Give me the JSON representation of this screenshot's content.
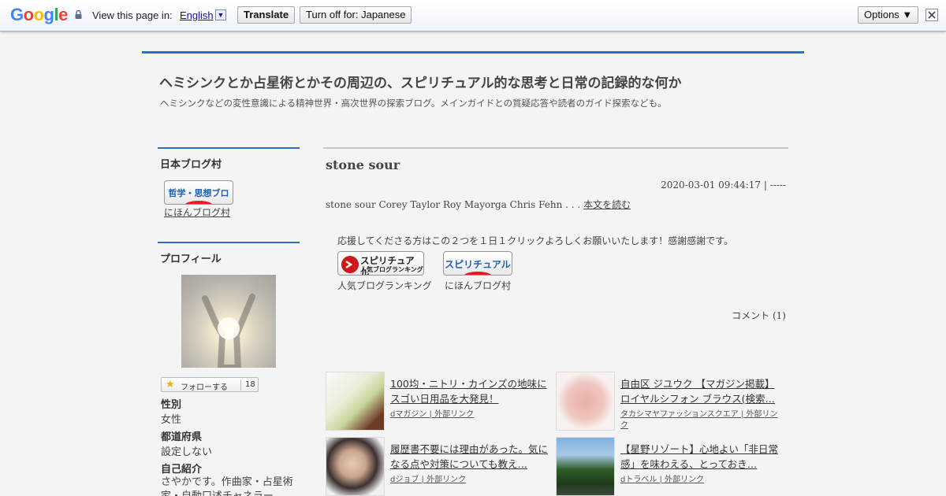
{
  "translate_bar": {
    "logo": "Google",
    "view_in": "View this page in:",
    "language": "English",
    "translate_button": "Translate",
    "turn_off_button": "Turn off for: Japanese",
    "options_button": "Options ▼",
    "icons": [
      "lock-icon",
      "close-icon",
      "dropdown-icon"
    ]
  },
  "blog": {
    "title": "ヘミシンクとか占星術とかその周辺の、スピリチュアル的な思考と日常の記録的な何か",
    "description": "ヘミシンクなどの変性意識による精神世界・高次世界の探索ブログ。メインガイドとの質疑応答や読者のガイド探索なども。"
  },
  "sidebar": {
    "village": {
      "heading": "日本ブログ村",
      "badge_text": "哲学・思想ブログ",
      "link": "にほんブログ村"
    },
    "profile": {
      "heading": "プロフィール",
      "follow_label": "フォローする",
      "follow_count": "18",
      "gender_label": "性別",
      "gender_value": "女性",
      "prefecture_label": "都道府県",
      "prefecture_value": "設定しない",
      "intro_label": "自己紹介",
      "intro_value": "さやかです。作曲家・占星術家・自動口述チャネラー"
    }
  },
  "post": {
    "title": "stone sour",
    "date": "2020-03-01 09:44:17 | -----",
    "body": "stone sour Corey Taylor Roy Mayorga Chris Fehn . . .",
    "read_more": "本文を読む",
    "support_text": "応援してくださる方はこの２つを１日１クリックよろしくお願いいたします！感謝感謝です。",
    "rank1_badge_top": "スピリチュアル",
    "rank1_badge_sub": "人気ブログランキング",
    "rank1_label": "人気ブログランキング",
    "rank2_badge": "スピリチュアル",
    "rank2_label": "にほんブログ村",
    "comment": "コメント (1)"
  },
  "ads": [
    {
      "title": "100均・ニトリ・カインズの地味にスゴい日用品を大発見！",
      "source": "dマガジン | 外部リンク"
    },
    {
      "title": "自由区 ジユウク 【マガジン掲載】ロイヤルシフォン ブラウス(検索…",
      "source": "タカシマヤファッションスクエア | 外部リンク"
    },
    {
      "title": "履歴書不要には理由があった。気になる点や対策についても教え…",
      "source": "dジョブ | 外部リンク"
    },
    {
      "title": "【星野リゾート】心地よい「非日常感」を味わえる、とっておき…",
      "source": "dトラベル | 外部リンク"
    }
  ],
  "colors": {
    "accent_blue": "#2a6fc4",
    "link_blue": "#1a0dab",
    "rank_red": "#e02020"
  }
}
